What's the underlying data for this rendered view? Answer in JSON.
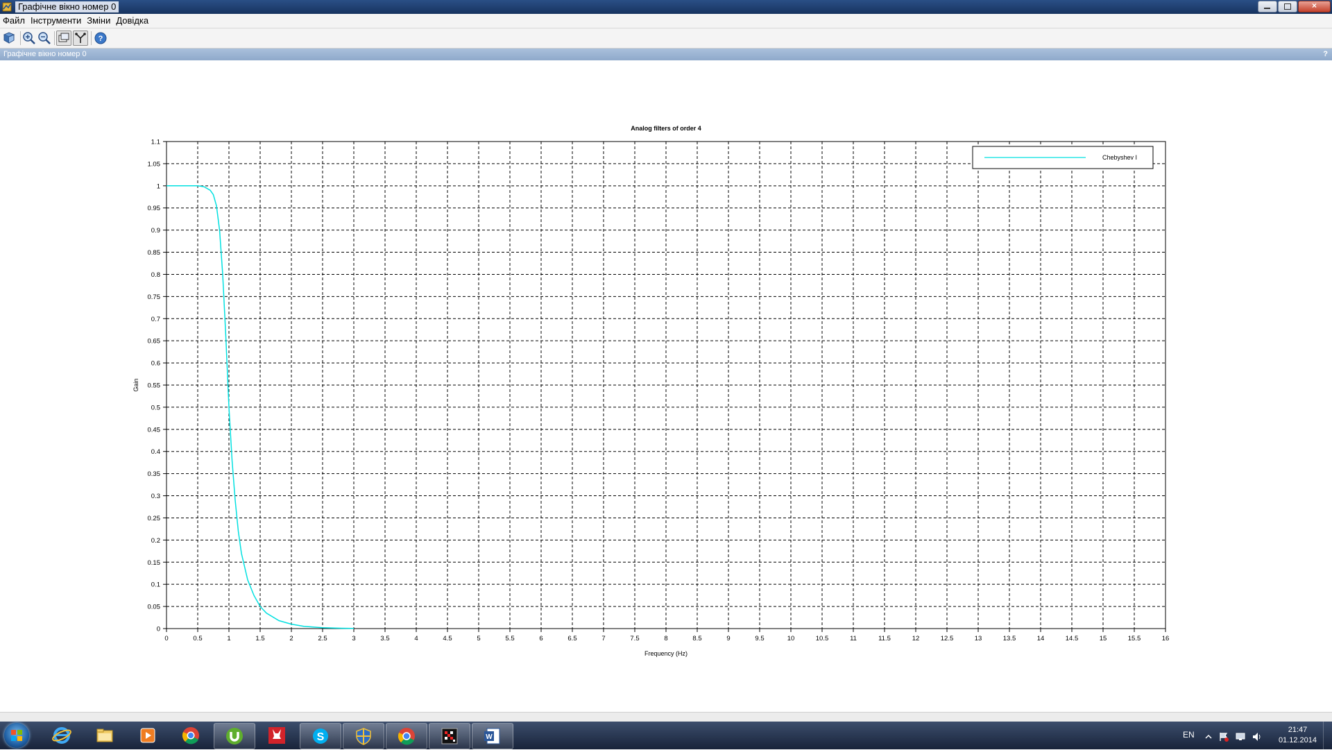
{
  "window": {
    "title": "Графічне вікно номер 0",
    "controls": [
      "minimize-icon",
      "restore-icon",
      "close-icon"
    ]
  },
  "menubar": {
    "items": [
      "Файл",
      "Інструменти",
      "Зміни",
      "Довідка"
    ]
  },
  "toolbar": {
    "buttons": [
      "rotate-icon",
      "zoom-in-icon",
      "zoom-out-icon",
      "datatip-icon",
      "edit-axes-icon",
      "help-icon"
    ]
  },
  "docbar": {
    "name": "Графічне вікно номер 0",
    "help": "?"
  },
  "colors": {
    "series": "#00e0e0",
    "grid": "#000000",
    "titlebar": "#1f3d6b",
    "taskbar": "#1d2a44"
  },
  "chart_data": {
    "type": "line",
    "title": "Analog filters of order 4",
    "xlabel": "Frequency (Hz)",
    "ylabel": "Gain",
    "xlim": [
      0,
      16
    ],
    "ylim": [
      0,
      1.1
    ],
    "xticks": [
      "0",
      "0.5",
      "1",
      "1.5",
      "2",
      "2.5",
      "3",
      "3.5",
      "4",
      "4.5",
      "5",
      "5.5",
      "6",
      "6.5",
      "7",
      "7.5",
      "8",
      "8.5",
      "9",
      "9.5",
      "10",
      "10.5",
      "11",
      "11.5",
      "12",
      "12.5",
      "13",
      "13.5",
      "14",
      "14.5",
      "15",
      "15.5",
      "16"
    ],
    "yticks": [
      "0",
      "0.05",
      "0.1",
      "0.15",
      "0.2",
      "0.25",
      "0.3",
      "0.35",
      "0.4",
      "0.45",
      "0.5",
      "0.55",
      "0.6",
      "0.65",
      "0.7",
      "0.75",
      "0.8",
      "0.85",
      "0.9",
      "0.95",
      "1",
      "1.05",
      "1.1"
    ],
    "grid": true,
    "legend_position": "top-right",
    "series": [
      {
        "name": "Chebyshev I",
        "x": [
          0,
          0.3,
          0.5,
          0.6,
          0.7,
          0.75,
          0.8,
          0.85,
          0.9,
          0.95,
          1.0,
          1.05,
          1.1,
          1.15,
          1.2,
          1.3,
          1.4,
          1.5,
          1.6,
          1.8,
          2.0,
          2.2,
          2.5,
          2.8,
          3.0
        ],
        "y": [
          1,
          1,
          1,
          0.998,
          0.99,
          0.98,
          0.955,
          0.9,
          0.8,
          0.66,
          0.5,
          0.38,
          0.29,
          0.22,
          0.17,
          0.11,
          0.075,
          0.05,
          0.035,
          0.018,
          0.01,
          0.005,
          0.002,
          0.0008,
          0.0003
        ]
      }
    ]
  },
  "taskbar": {
    "apps": [
      "windows-start-icon",
      "internet-explorer-icon",
      "file-explorer-icon",
      "media-player-icon",
      "chrome-icon",
      "utorrent-icon",
      "zynga-icon",
      "skype-icon",
      "security-shield-icon",
      "chrome-user-icon",
      "scilab-icon",
      "word-icon"
    ],
    "language": "EN",
    "time": "21:47",
    "date": "01.12.2014"
  }
}
